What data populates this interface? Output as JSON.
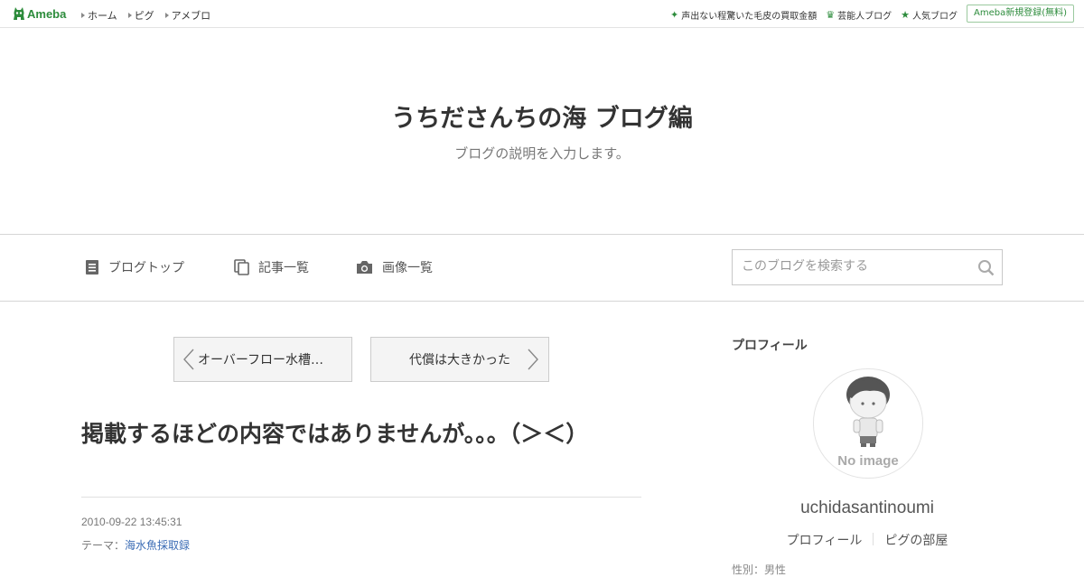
{
  "topbar": {
    "logo_text": "Ameba",
    "nav": [
      {
        "label": "ホーム"
      },
      {
        "label": "ピグ"
      },
      {
        "label": "アメブロ"
      }
    ],
    "links": [
      {
        "label": "声出ない程驚いた毛皮の買取金額",
        "icon": "sparkle-icon"
      },
      {
        "label": "芸能人ブログ",
        "icon": "crown-icon"
      },
      {
        "label": "人気ブログ",
        "icon": "star-icon"
      }
    ],
    "register_label": "Ameba新規登録(無料)",
    "accent_color": "#2d8c3c"
  },
  "header": {
    "title": "うちださんちの海 ブログ編",
    "description": "ブログの説明を入力します。"
  },
  "navbar": {
    "items": [
      {
        "label": "ブログトップ",
        "icon": "document-icon"
      },
      {
        "label": "記事一覧",
        "icon": "copy-icon"
      },
      {
        "label": "画像一覧",
        "icon": "camera-icon"
      }
    ],
    "search_placeholder": "このブログを検索する"
  },
  "article": {
    "prev_label": "オーバーフロー水槽…",
    "next_label": "代償は大きかった",
    "title": "掲載するほどの内容ではありませんが。。。（＞＜）",
    "date": "2010-09-22 13:45:31",
    "theme_prefix": "テーマ：",
    "theme": "海水魚採取録"
  },
  "sidebar": {
    "heading": "プロフィール",
    "avatar_text": "No image",
    "username": "uchidasantinoumi",
    "links": [
      {
        "label": "プロフィール"
      },
      {
        "label": "ピグの部屋"
      }
    ],
    "more_text": "性別：男性"
  }
}
